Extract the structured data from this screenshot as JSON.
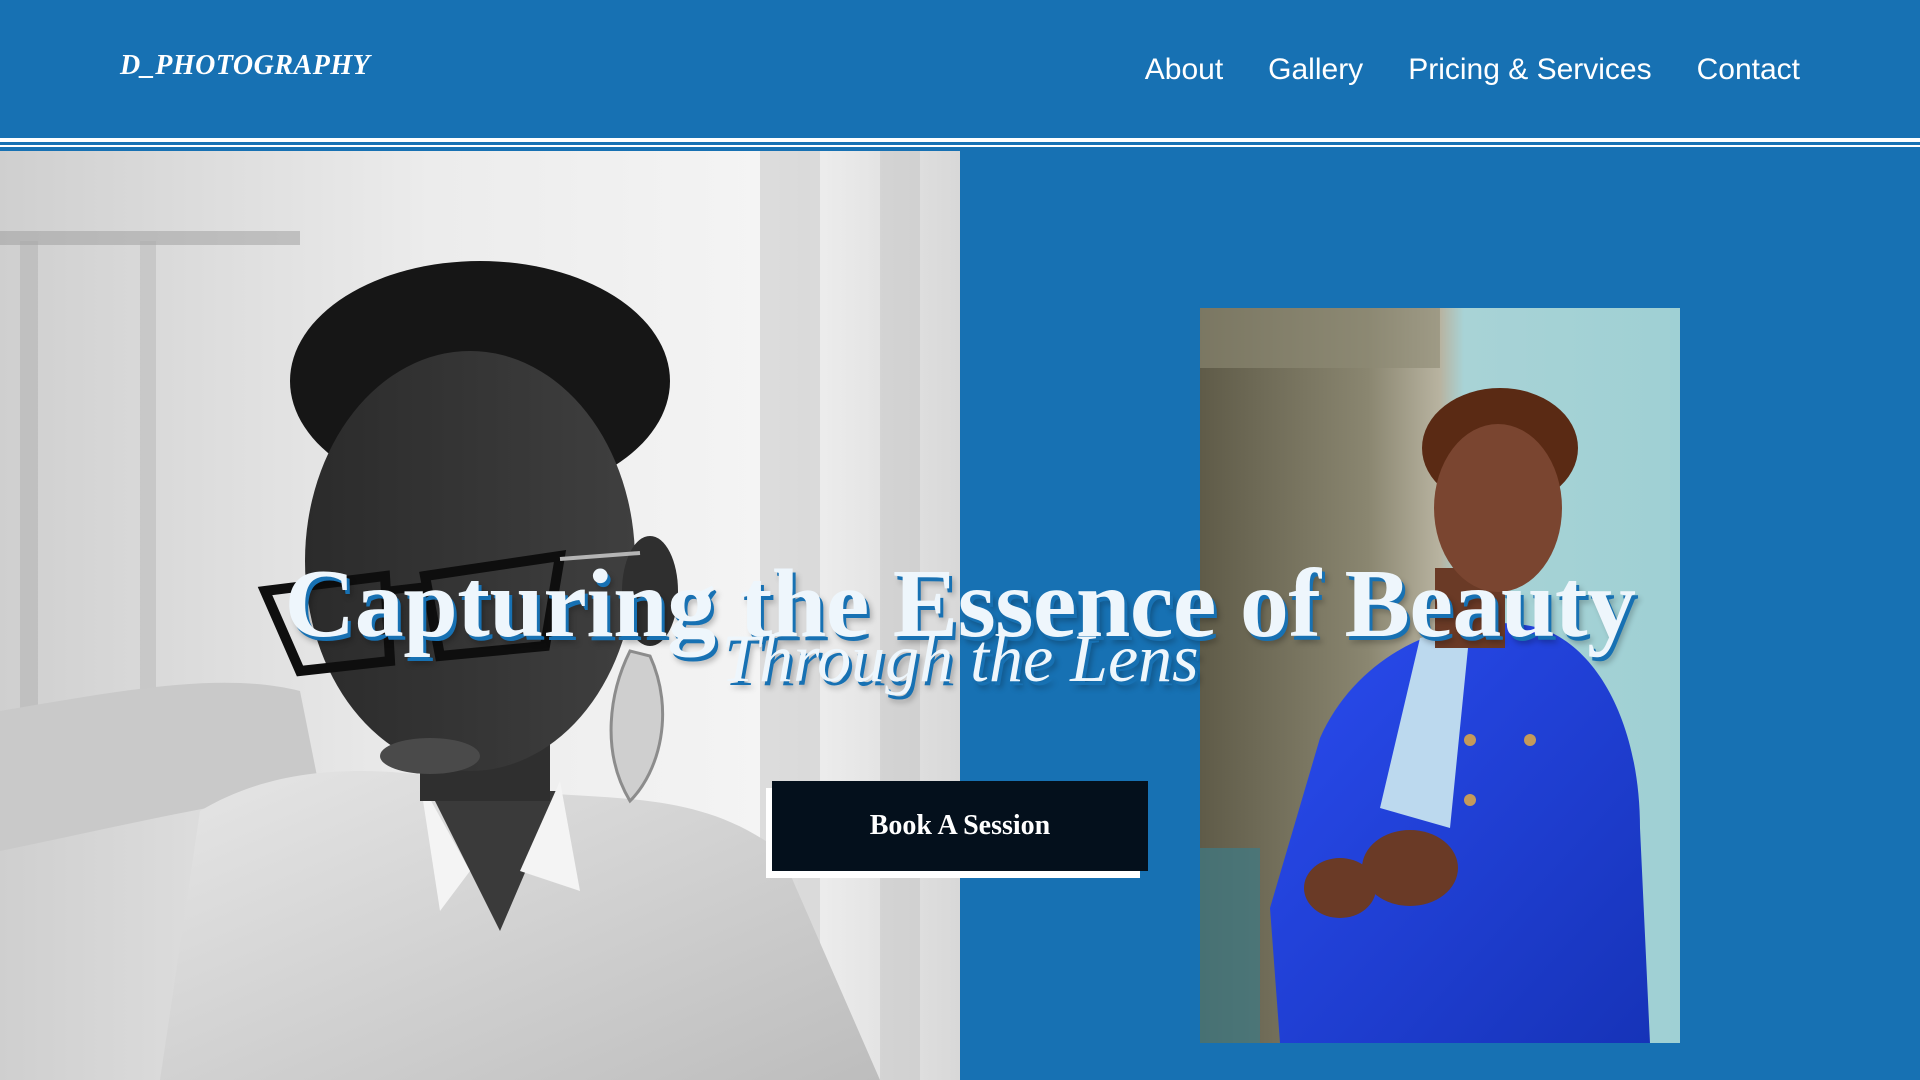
{
  "header": {
    "brand": "D_PHOTOGRAPHY",
    "nav": [
      {
        "label": "About"
      },
      {
        "label": "Gallery"
      },
      {
        "label": "Pricing & Services"
      },
      {
        "label": "Contact"
      }
    ]
  },
  "hero": {
    "headline": "Capturing the Essence of Beauty",
    "subheadline": "Through the Lens",
    "cta_label": "Book A Session"
  },
  "colors": {
    "brand_blue": "#1771b3",
    "cta_background": "#04101c",
    "text_white": "#ffffff",
    "jacket_blue": "#1f3fd6"
  }
}
